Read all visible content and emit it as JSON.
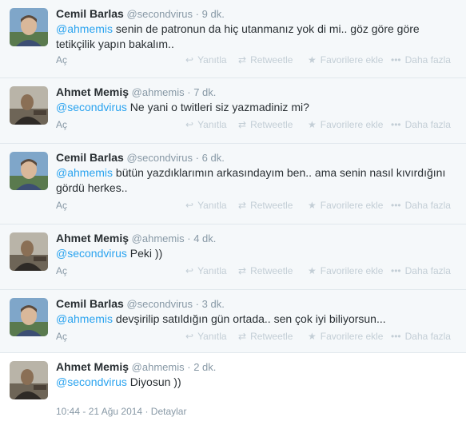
{
  "tweets": [
    {
      "name": "Cemil Barlas",
      "handle": "@secondvirus",
      "dot": "·",
      "time": "9 dk.",
      "mention": "@ahmemis",
      "text": " senin de patronun da hiç utanmanız yok di mi.. göz göre göre tetikçilik yapın bakalım..",
      "avatar": "cemil"
    },
    {
      "name": "Ahmet Memiş",
      "handle": "@ahmemis",
      "dot": "·",
      "time": "7 dk.",
      "mention": "@secondvirus",
      "text": " Ne yani o twitleri siz yazmadiniz mi?",
      "avatar": "ahmet"
    },
    {
      "name": "Cemil Barlas",
      "handle": "@secondvirus",
      "dot": "·",
      "time": "6 dk.",
      "mention": "@ahmemis",
      "text": " bütün yazdıklarımın arkasındayım ben.. ama senin nasıl kıvırdığını gördü herkes..",
      "avatar": "cemil"
    },
    {
      "name": "Ahmet Memiş",
      "handle": "@ahmemis",
      "dot": "·",
      "time": "4 dk.",
      "mention": "@secondvirus",
      "text": " Peki ))",
      "avatar": "ahmet"
    },
    {
      "name": "Cemil Barlas",
      "handle": "@secondvirus",
      "dot": "·",
      "time": "3 dk.",
      "mention": "@ahmemis",
      "text": " devşirilip satıldığın gün ortada.. sen çok iyi biliyorsun...",
      "avatar": "cemil"
    },
    {
      "name": "Ahmet Memiş",
      "handle": "@ahmemis",
      "dot": "·",
      "time": "2 dk.",
      "mention": "@secondvirus",
      "text": " Diyosun ))",
      "avatar": "ahmet"
    }
  ],
  "actions": {
    "open": "Aç",
    "reply": "Yanıtla",
    "retweet": "Retweetle",
    "favorite": "Favorilere ekle",
    "more": "Daha fazla",
    "reply_icon": "reply-icon",
    "retweet_icon": "retweet-icon",
    "favorite_icon": "star-icon",
    "more_icon": "more-dots-icon"
  },
  "footer": {
    "timestamp": "10:44 - 21 Ağu 2014",
    "dot": "·",
    "details": "Detaylar"
  },
  "colors": {
    "mention": "#2aa3ef",
    "muted": "#8899a6",
    "background": "#f5f8fa",
    "divider": "#e1e8ed"
  }
}
